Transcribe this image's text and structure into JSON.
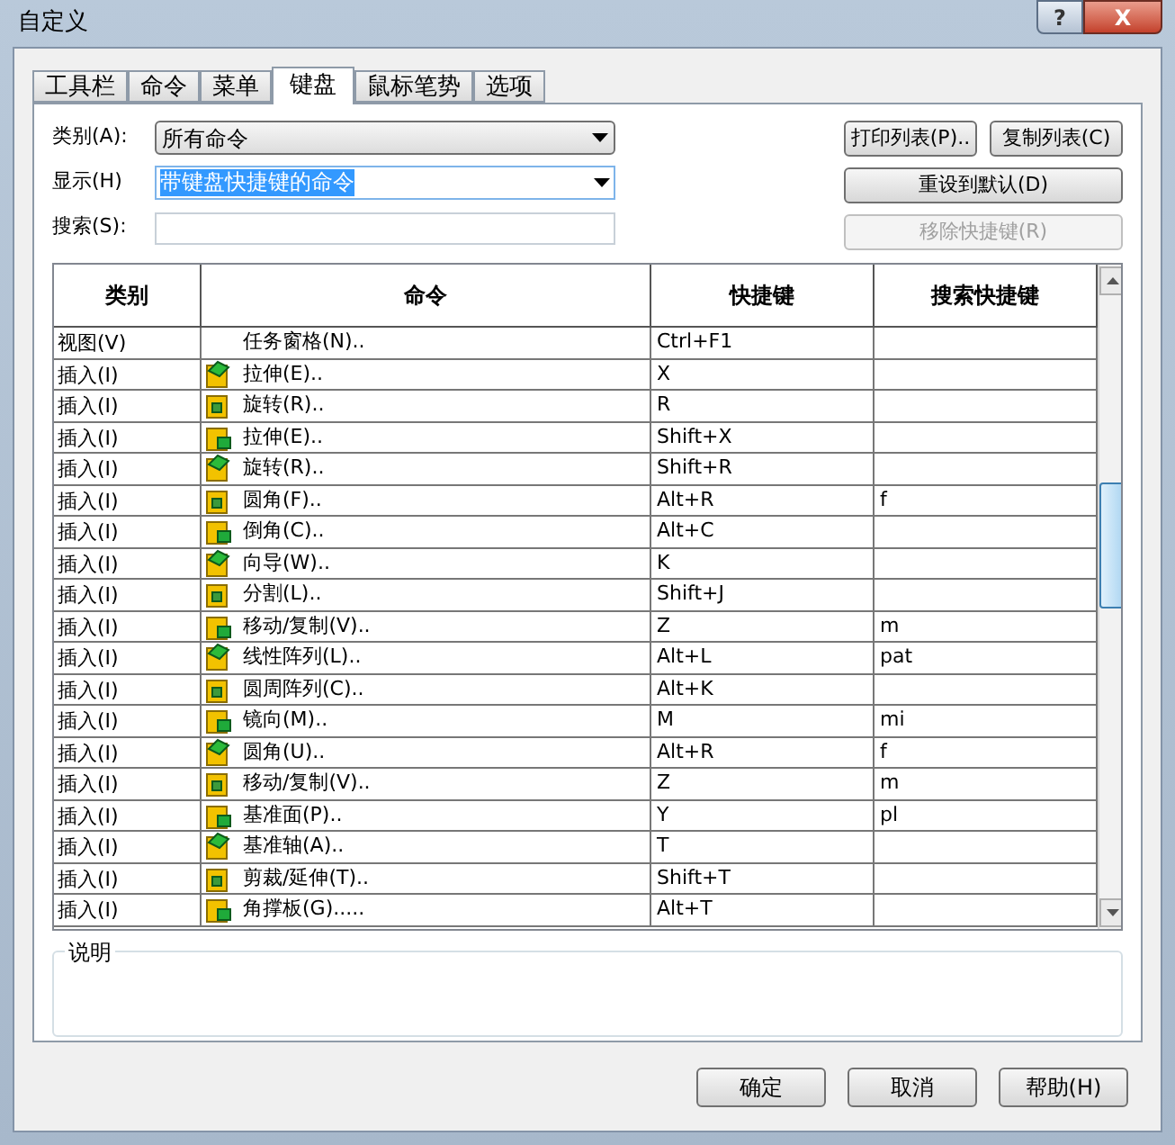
{
  "window": {
    "title": "自定义",
    "help": "?",
    "close": "X"
  },
  "tabs": [
    {
      "label": "工具栏",
      "selected": false
    },
    {
      "label": "命令",
      "selected": false
    },
    {
      "label": "菜单",
      "selected": false
    },
    {
      "label": "键盘",
      "selected": true
    },
    {
      "label": "鼠标笔势",
      "selected": false
    },
    {
      "label": "选项",
      "selected": false
    }
  ],
  "form": {
    "category": {
      "label": "类别(A):",
      "value": "所有命令"
    },
    "show": {
      "label": "显示(H)",
      "value": "带键盘快捷键的命令"
    },
    "search": {
      "label": "搜索(S):"
    }
  },
  "side_buttons": [
    {
      "label": "打印列表(P)..",
      "disabled": false
    },
    {
      "label": "复制列表(C)",
      "disabled": false
    },
    {
      "label": "重设到默认(D)",
      "disabled": false
    },
    {
      "label": "移除快捷键(R)",
      "disabled": true
    }
  ],
  "table": {
    "columns": [
      "类别",
      "命令",
      "快捷键",
      "搜索快捷键"
    ],
    "rows": [
      {
        "category": "视图(V)",
        "command": "任务窗格(N)..",
        "shortcut": "Ctrl+F1",
        "kind": "plain"
      },
      {
        "category": "插入(I)",
        "command": "拉伸(E)..",
        "shortcut": "X",
        "kind": "tool"
      },
      {
        "category": "插入(I)",
        "command": "旋转(R)..",
        "shortcut": "R",
        "kind": "tool"
      },
      {
        "category": "插入(I)",
        "command": "拉伸(E)..",
        "shortcut": "Shift+X",
        "kind": "tool"
      },
      {
        "category": "插入(I)",
        "command": "旋转(R)..",
        "shortcut": "Shift+R",
        "kind": "tool"
      },
      {
        "category": "插入(I)",
        "command": "圆角(F)..",
        "shortcut": "Alt+R",
        "search": "f",
        "kind": "tool"
      },
      {
        "category": "插入(I)",
        "command": "倒角(C)..",
        "shortcut": "Alt+C",
        "kind": "tool"
      },
      {
        "category": "插入(I)",
        "command": "向导(W)..",
        "shortcut": "K",
        "kind": "tool"
      },
      {
        "category": "插入(I)",
        "command": "分割(L)..",
        "shortcut": "Shift+J",
        "kind": "tool"
      },
      {
        "category": "插入(I)",
        "command": "移动/复制(V)..",
        "shortcut": "Z",
        "search": "m",
        "kind": "tool"
      },
      {
        "category": "插入(I)",
        "command": "线性阵列(L)..",
        "shortcut": "Alt+L",
        "search": "pat",
        "kind": "tool"
      },
      {
        "category": "插入(I)",
        "command": "圆周阵列(C)..",
        "shortcut": "Alt+K",
        "kind": "tool"
      },
      {
        "category": "插入(I)",
        "command": "镜向(M)..",
        "shortcut": "M",
        "search": "mi",
        "kind": "tool"
      },
      {
        "category": "插入(I)",
        "command": "圆角(U)..",
        "shortcut": "Alt+R",
        "search": "f",
        "kind": "tool"
      },
      {
        "category": "插入(I)",
        "command": "移动/复制(V)..",
        "shortcut": "Z",
        "search": "m",
        "kind": "tool"
      },
      {
        "category": "插入(I)",
        "command": "基准面(P)..",
        "shortcut": "Y",
        "search": "pl",
        "kind": "tool"
      },
      {
        "category": "插入(I)",
        "command": "基准轴(A)..",
        "shortcut": "T",
        "kind": "tool"
      },
      {
        "category": "插入(I)",
        "command": "剪裁/延伸(T)..",
        "shortcut": "Shift+T",
        "kind": "tool"
      },
      {
        "category": "插入(I)",
        "command": "角撑板(G).....",
        "shortcut": "Alt+T",
        "kind": "tool"
      }
    ]
  },
  "description": {
    "label": "说明"
  },
  "buttons": [
    "确定",
    "取消",
    "帮助(H)"
  ]
}
